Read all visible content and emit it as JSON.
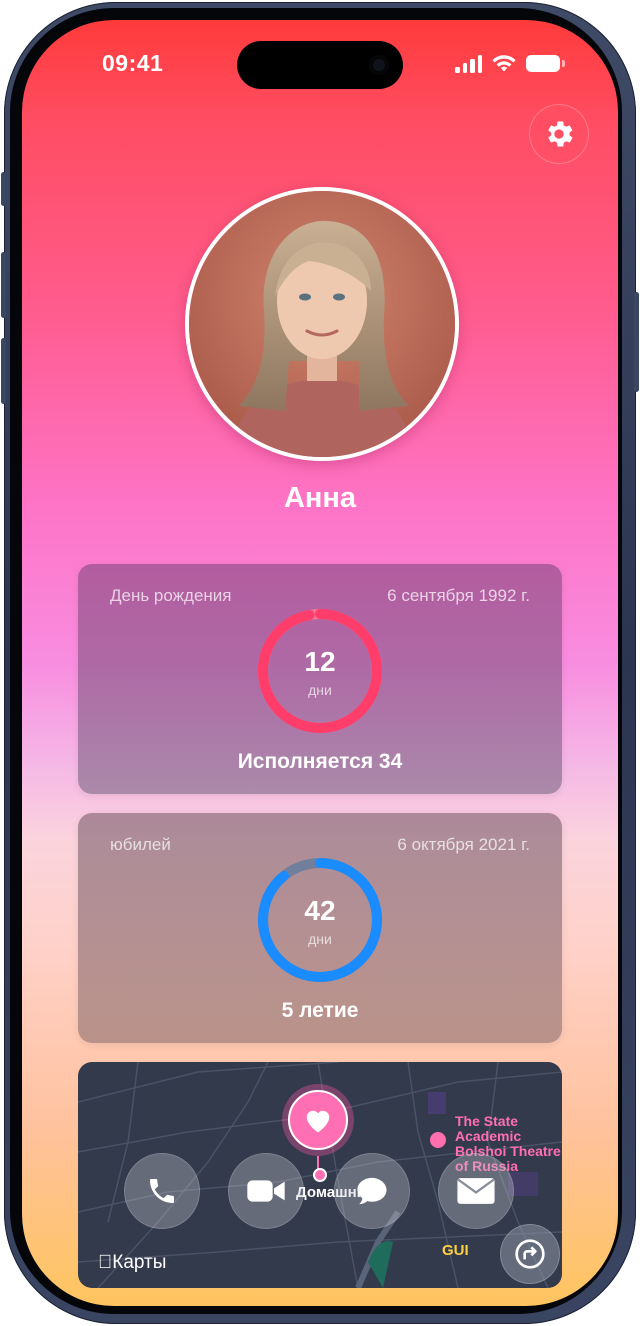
{
  "status_bar": {
    "time": "09:41"
  },
  "profile": {
    "name": "Анна"
  },
  "cards": [
    {
      "label": "День рождения",
      "date": "6 сентября 1992 г.",
      "days": "12",
      "unit": "дни",
      "caption": "Исполняется 34",
      "progress": 0.97,
      "color": "#ff3d6b",
      "track": "#ff7a9e"
    },
    {
      "label": "юбилей",
      "date": "6 октября 2021 г.",
      "days": "42",
      "unit": "дни",
      "caption": "5 летие",
      "progress": 0.89,
      "color": "#1a8cff",
      "track": "#6f7f9c"
    }
  ],
  "map": {
    "attribution": "Карты",
    "home_label": "Домашний",
    "poi": "The State Academic Bolshoi Theatre of Russia",
    "guide_label": "GUI"
  },
  "actions": {
    "phone": "phone-icon",
    "video": "video-icon",
    "message": "message-icon",
    "mail": "mail-icon",
    "share": "share-icon"
  }
}
